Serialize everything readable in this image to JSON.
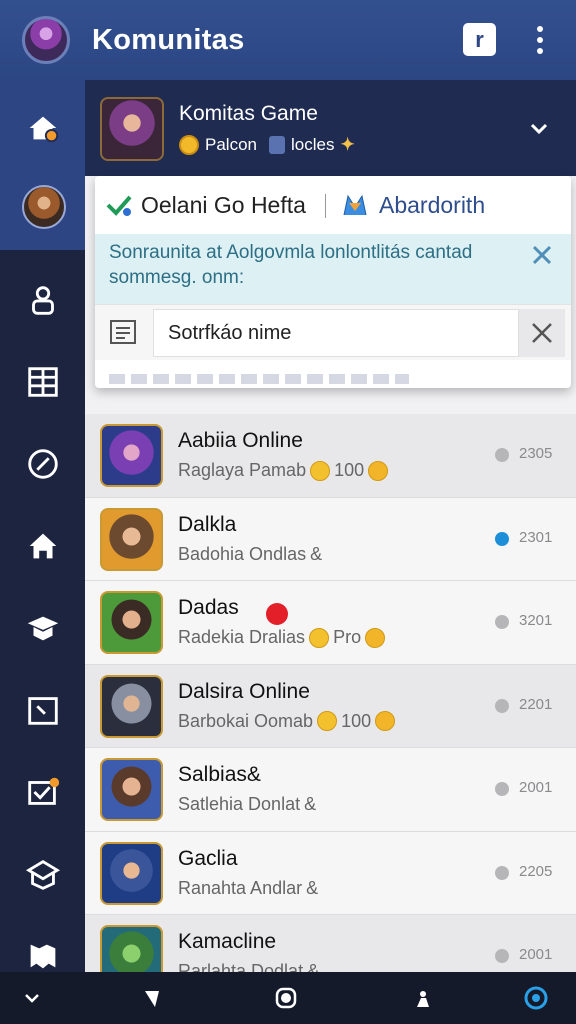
{
  "app": {
    "title": "Komunitas"
  },
  "topbar": {
    "action_glyph": "r"
  },
  "game": {
    "title": "Komitas Game",
    "sub_a": "Palcon",
    "sub_b": "locles"
  },
  "popup": {
    "tab1_label": "Oelani Go Hefta",
    "tab2_label": "Abardorith",
    "info_text": "Sonraunita at Aolgovmla lonlontlitás cantad sommesg. onm:",
    "notification_placeholder": "Sotrfkáo nime"
  },
  "list": [
    {
      "name": "Aabiia Online",
      "desc": "Raglaya Pamab",
      "extra": "100",
      "count": "2305",
      "status": "grey"
    },
    {
      "name": "Dalkla",
      "desc": "Badohia Ondlas",
      "extra": "&",
      "count": "2301",
      "status": "blue"
    },
    {
      "name": "Dadas",
      "desc": "Radekia Dralias",
      "extra": "Pro",
      "count": "3201",
      "status": "grey"
    },
    {
      "name": "Dalsira Online",
      "desc": "Barbokai Oomab",
      "extra": "100",
      "count": "2201",
      "status": "grey"
    },
    {
      "name": "Salbias&",
      "desc": "Satlehia Donlat",
      "extra": "&",
      "count": "2001",
      "status": "grey"
    },
    {
      "name": "Gaclia",
      "desc": "Ranahta Andlar",
      "extra": "&",
      "count": "2205",
      "status": "grey"
    },
    {
      "name": "Kamacline",
      "desc": "Rarlahta Dodlat",
      "extra": "&",
      "count": "2001",
      "status": "grey"
    }
  ],
  "colors": {
    "topbar": "#2c4684",
    "rail": "#1c2440",
    "accent": "#1d8fd8"
  },
  "icons": {
    "rail": [
      "home-icon",
      "avatar",
      "user-icon",
      "grid-icon",
      "compass-icon",
      "house-icon",
      "graduation-icon",
      "clock-icon",
      "mail-check-icon",
      "box-icon",
      "puzzle-icon"
    ],
    "bottom": [
      "chevron-down-icon",
      "back-icon",
      "home-circle-icon",
      "person-icon",
      "assistant-icon"
    ]
  }
}
